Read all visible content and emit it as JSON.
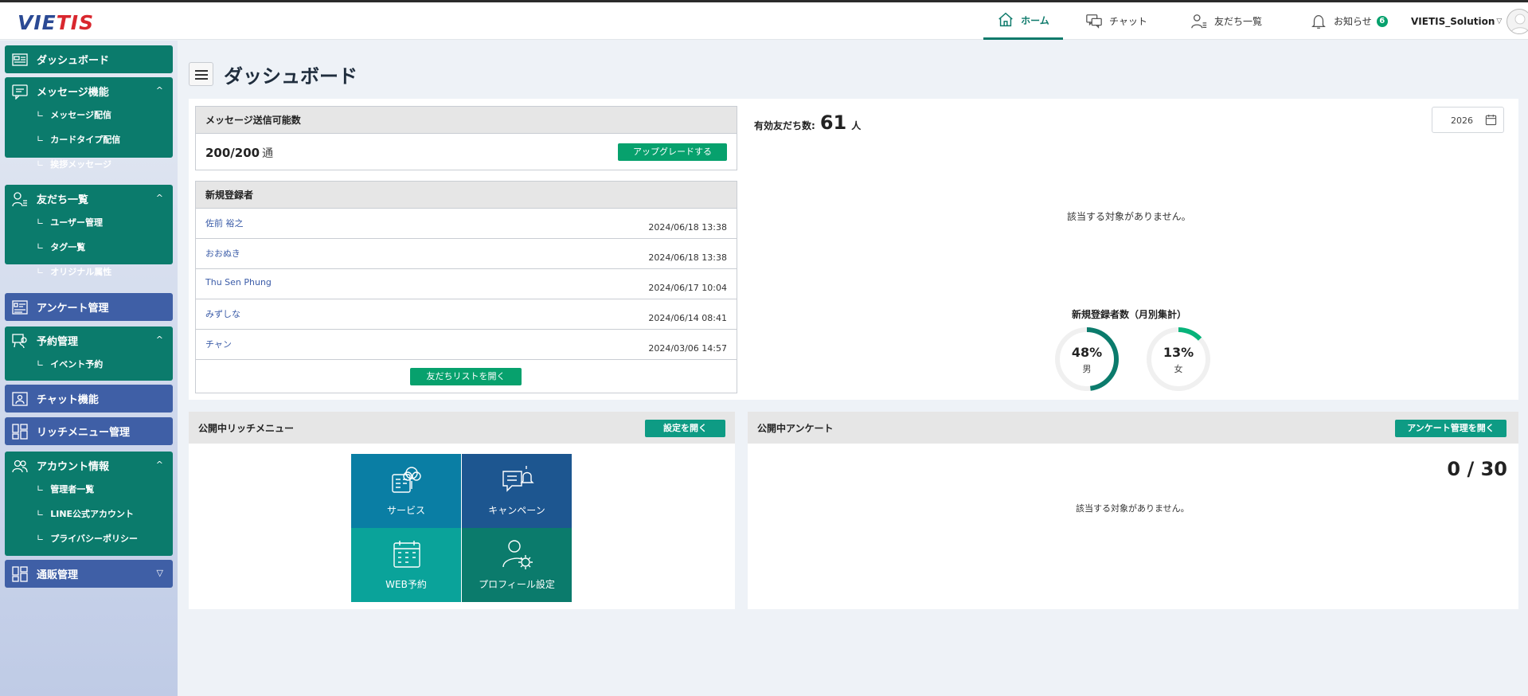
{
  "header": {
    "logo_left": "VIE",
    "logo_right": "TIS",
    "nav": [
      {
        "label": "ホーム",
        "icon": "home-icon"
      },
      {
        "label": "チャット",
        "icon": "chat-icon"
      },
      {
        "label": "友だち一覧",
        "icon": "person-list-icon"
      },
      {
        "label": "お知らせ",
        "icon": "bell-icon",
        "badge": "6"
      }
    ],
    "user_name": "VIETIS_Solution",
    "user_caret": "▽"
  },
  "sidebar": {
    "dashboard": "ダッシュボード",
    "message": {
      "label": "メッセージ機能",
      "items": [
        "メッセージ配信",
        "カードタイプ配信",
        "挨拶メッセージ"
      ]
    },
    "friends": {
      "label": "友だち一覧",
      "items": [
        "ユーザー管理",
        "タグ一覧",
        "オリジナル属性"
      ]
    },
    "survey": "アンケート管理",
    "reservation": {
      "label": "予約管理",
      "items": [
        "イベント予約"
      ]
    },
    "chat": "チャット機能",
    "richmenu": "リッチメニュー管理",
    "account": {
      "label": "アカウント情報",
      "items": [
        "管理者一覧",
        "LINE公式アカウント",
        "プライバシーポリシー"
      ]
    },
    "ecommerce": "通販管理",
    "sub_prefix": "∟",
    "chev_up": "^",
    "chev_down": "▽"
  },
  "main": {
    "title": "ダッシュボード",
    "message_count": {
      "title": "メッセージ送信可能数",
      "value": "200/200",
      "unit": "通",
      "upgrade_label": "アップグレードする"
    },
    "new_registrants": {
      "title": "新規登録者",
      "rows": [
        {
          "name": "佐前 裕之",
          "date": "2024/06/18 13:38"
        },
        {
          "name": "おおぬき",
          "date": "2024/06/18 13:38"
        },
        {
          "name": "Thu Sen Phung",
          "date": "2024/06/17 10:04"
        },
        {
          "name": "みずしな",
          "date": "2024/06/14 08:41"
        },
        {
          "name": "チャン",
          "date": "2024/03/06 14:57"
        }
      ],
      "button_label": "友だちリストを開く"
    },
    "active_friends": {
      "label": "有効友だち数:",
      "value": "61",
      "unit": "人"
    },
    "year": "2026",
    "empty_text": "該当する対象がありません。",
    "gender_chart": {
      "title": "新規登録者数（月別集計）",
      "items": [
        {
          "percent": "48%",
          "label": "男",
          "value": 48,
          "color": "#0b7b6c"
        },
        {
          "percent": "13%",
          "label": "女",
          "value": 13,
          "color": "#07b37a"
        }
      ]
    },
    "richmenu": {
      "title": "公開中リッチメニュー",
      "button_label": "設定を開く",
      "tiles": [
        {
          "label": "サービス",
          "color": "#0a7ea4",
          "icon": "service-icon"
        },
        {
          "label": "キャンペーン",
          "color": "#1d5690",
          "icon": "campaign-icon"
        },
        {
          "label": "WEB予約",
          "color": "#0aa39a",
          "icon": "calendar-icon"
        },
        {
          "label": "プロフィール設定",
          "color": "#0b7b6c",
          "icon": "profile-settings-icon"
        }
      ]
    },
    "survey": {
      "title": "公開中アンケート",
      "button_label": "アンケート管理を開く",
      "count": "0 / 30",
      "empty_text": "該当する対象がありません。"
    }
  }
}
